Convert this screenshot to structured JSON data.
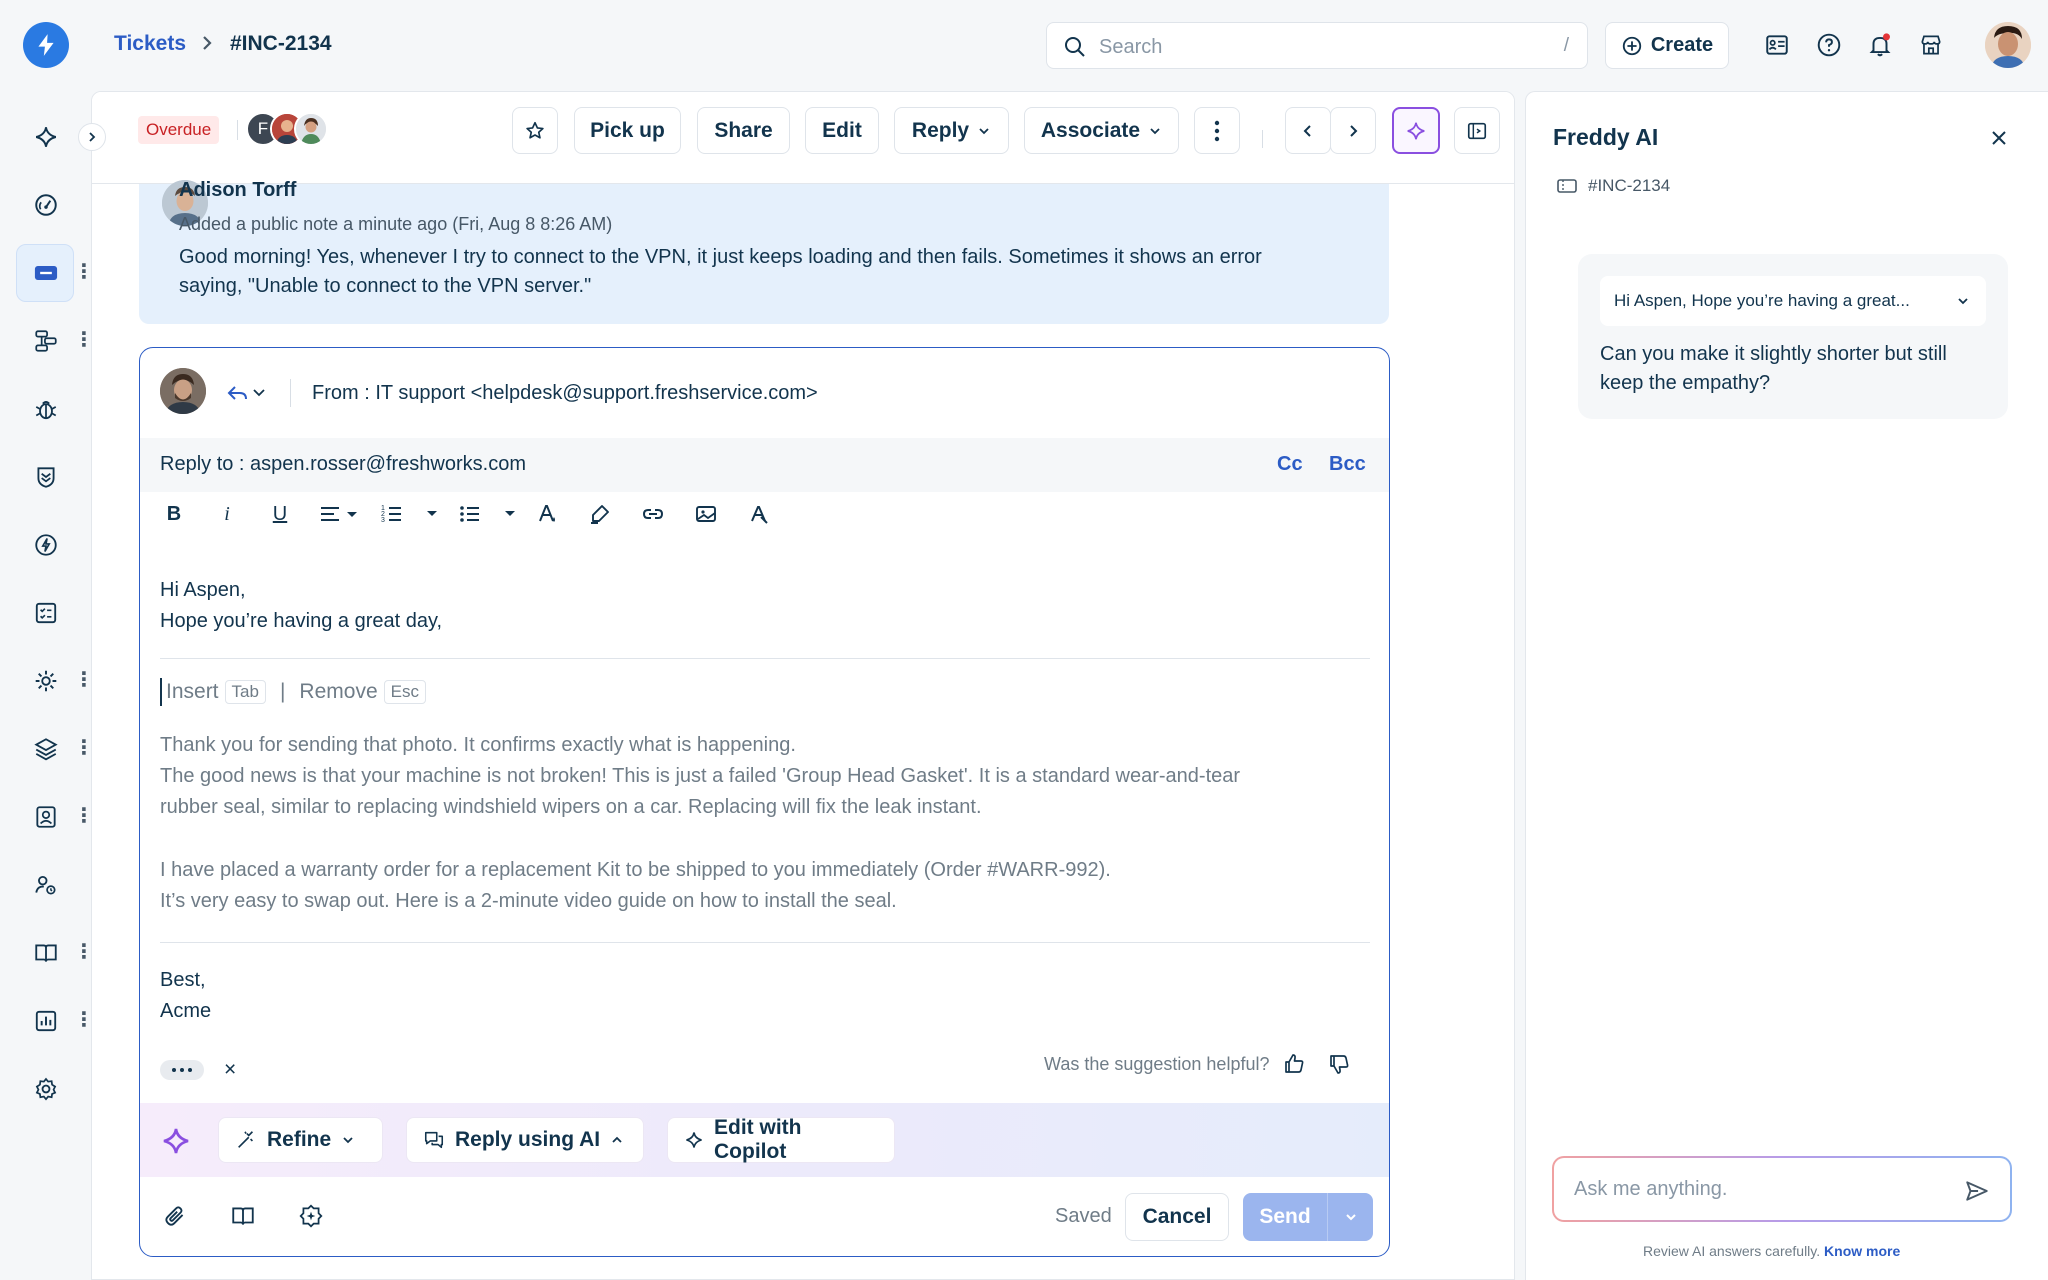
{
  "breadcrumb": {
    "root": "Tickets",
    "current": "#INC-2134"
  },
  "search": {
    "placeholder": "Search",
    "shortcut": "/"
  },
  "top_actions": {
    "create": "Create"
  },
  "toolbar": {
    "status_badge": "Overdue",
    "avatar_initial": "F",
    "pick_up": "Pick up",
    "share": "Share",
    "edit": "Edit",
    "reply": "Reply",
    "associate": "Associate"
  },
  "note": {
    "author": "Adison Torff",
    "meta": "Added a public note a minute ago (Fri, Aug 8 8:26 AM)",
    "body": "Good morning! Yes, whenever I try to connect to the VPN, it just keeps loading and then fails. Sometimes it shows an error saying, \"Unable to connect to the VPN server.\""
  },
  "composer": {
    "from_label": "From : ",
    "from_value": "IT support <helpdesk@support.freshservice.com>",
    "reply_to_label": "Reply to : ",
    "reply_to_value": "aspen.rosser@freshworks.com",
    "cc": "Cc",
    "bcc": "Bcc",
    "greeting_1": "Hi Aspen,",
    "greeting_2": "Hope you’re having a great day,",
    "insert": "Insert",
    "insert_key": "Tab",
    "remove": "Remove",
    "remove_key": "Esc",
    "suggestion": [
      "Thank you for sending that photo. It confirms exactly what is happening.",
      "The good news is that your machine is not broken! This is just a failed 'Group Head Gasket'. It is a standard wear-and-tear",
      "rubber seal, similar to replacing windshield wipers on a car. Replacing will fix the leak instant.",
      "I have placed a warranty order for a replacement Kit to be shipped to you immediately (Order #WARR-992).",
      "It’s very easy to swap out. Here is a 2-minute video guide on how to install the seal."
    ],
    "signoff_1": "Best,",
    "signoff_2": "Acme",
    "close_x": "×",
    "feedback_question": "Was the suggestion helpful?",
    "refine": "Refine",
    "reply_using_ai": "Reply using AI",
    "edit_with_copilot": "Edit with Copilot",
    "saved": "Saved",
    "cancel": "Cancel",
    "send": "Send"
  },
  "freddy": {
    "title": "Freddy AI",
    "ticket": "#INC-2134",
    "chip_preview": "Hi Aspen, Hope you’re having a great...",
    "user_message": "Can you make it slightly shorter but still keep the empathy?",
    "ask_placeholder": "Ask me anything.",
    "disclaimer": "Review AI answers carefully.",
    "know_more": "Know more"
  },
  "colors": {
    "brand_blue": "#2c5cc5",
    "logo_blue": "#2a7ae2",
    "overdue_red": "#c82124",
    "ai_purple": "#8a4fe0",
    "send_disabled": "#9bb5ee"
  }
}
